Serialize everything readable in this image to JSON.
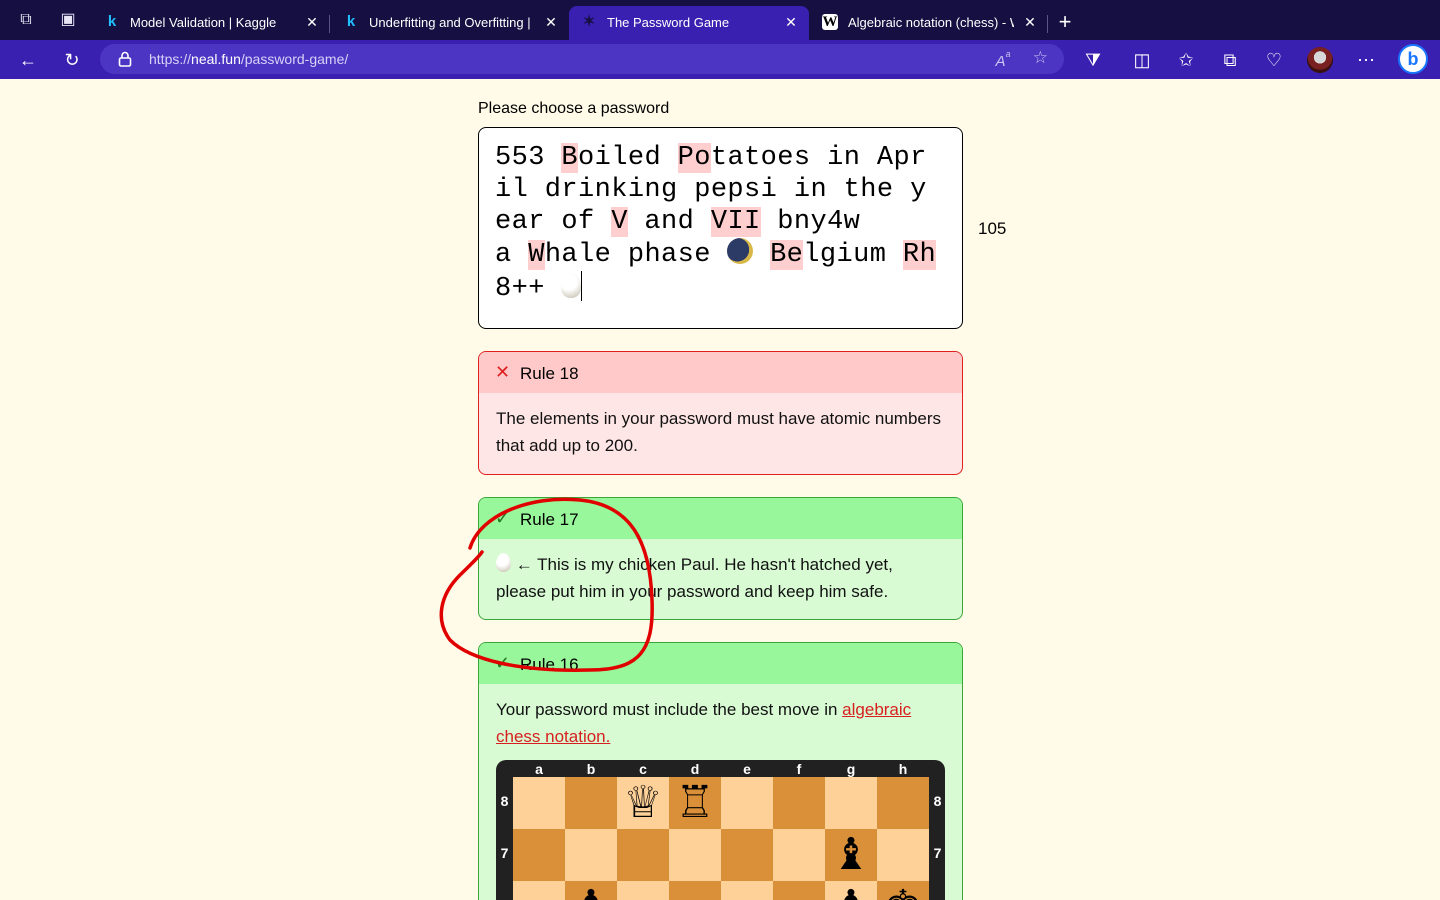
{
  "browser": {
    "tabs": [
      {
        "title": "Model Validation | Kaggle",
        "favicon": "kaggle-icon",
        "active": false
      },
      {
        "title": "Underfitting and Overfitting | K",
        "favicon": "kaggle-icon",
        "active": false
      },
      {
        "title": "The Password Game",
        "favicon": "star-icon",
        "active": true
      },
      {
        "title": "Algebraic notation (chess) - W",
        "favicon": "wikipedia-icon",
        "active": false
      }
    ],
    "url_prefix": "https://",
    "url_host": "neal.fun",
    "url_path": "/password-game/"
  },
  "page": {
    "prompt": "Please choose a password",
    "password_segments": [
      {
        "t": "553 ",
        "hl": false
      },
      {
        "t": "B",
        "hl": true
      },
      {
        "t": "oiled ",
        "hl": false
      },
      {
        "t": "Po",
        "hl": true
      },
      {
        "t": "tatoes in Apr\nil drinking pepsi in the y\near of ",
        "hl": false
      },
      {
        "t": "V",
        "hl": true
      },
      {
        "t": " and ",
        "hl": false
      },
      {
        "t": "VII",
        "hl": true
      },
      {
        "t": " bny4w\na ",
        "hl": false
      },
      {
        "t": "W",
        "hl": true
      },
      {
        "t": "hale phase ",
        "hl": false
      },
      {
        "t": "moon",
        "emoji": true
      },
      {
        "t": " ",
        "hl": false
      },
      {
        "t": "Be",
        "hl": true
      },
      {
        "t": "lgium ",
        "hl": false
      },
      {
        "t": "Rh",
        "hl": true
      },
      {
        "t": "\n8++ ",
        "hl": false
      },
      {
        "t": "egg",
        "emoji": true
      }
    ],
    "char_count": "105",
    "rules": [
      {
        "status": "fail",
        "title": "Rule 18",
        "text": "The elements in your password must have atomic numbers that add up to 200."
      },
      {
        "status": "pass",
        "title": "Rule 17",
        "text": "← This is my chicken Paul. He hasn't hatched yet, please put him in your password and keep him safe."
      },
      {
        "status": "pass",
        "title": "Rule 16",
        "text": "Your password must include the best move in ",
        "link": "algebraic chess notation."
      }
    ],
    "chess": {
      "files": [
        "a",
        "b",
        "c",
        "d",
        "e",
        "f",
        "g",
        "h"
      ],
      "ranks_visible": [
        "8",
        "7"
      ],
      "pieces": [
        {
          "square": "c8",
          "glyph": "♕",
          "name": "white-queen"
        },
        {
          "square": "d8",
          "glyph": "♖",
          "name": "white-rook"
        },
        {
          "square": "g7",
          "glyph": "♝",
          "name": "black-bishop"
        },
        {
          "square": "b6",
          "glyph": "♟",
          "name": "black-pawn"
        },
        {
          "square": "g6",
          "glyph": "♟",
          "name": "black-pawn"
        },
        {
          "square": "h6",
          "glyph": "♚",
          "name": "black-king"
        }
      ]
    }
  },
  "colors": {
    "page_bg": "#fffbe8",
    "fail": "#e01f1f",
    "pass": "#98f79a",
    "annotation": "#e00000"
  }
}
